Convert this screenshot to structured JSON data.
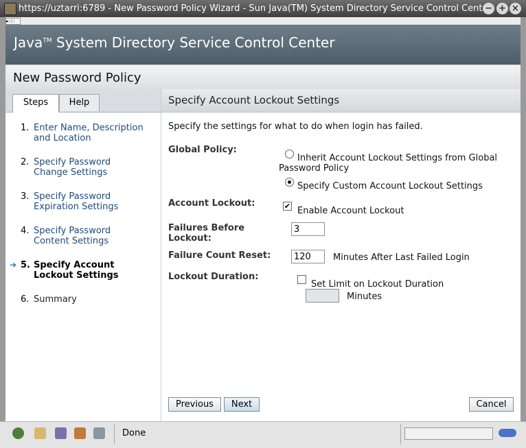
{
  "window": {
    "title": "https://uztarri:6789 - New Password Policy Wizard - Sun Java(TM) System Directory Service Control Center"
  },
  "banner": {
    "product_main": "Java",
    "product_tm": "TM",
    "product_rest": " System Directory Service Control Center"
  },
  "page": {
    "title": "New Password Policy"
  },
  "tabs": [
    {
      "label": "Steps"
    },
    {
      "label": "Help"
    }
  ],
  "steps": [
    {
      "num": "1.",
      "label": "Enter Name, Description and Location"
    },
    {
      "num": "2.",
      "label": "Specify Password Change Settings"
    },
    {
      "num": "3.",
      "label": "Specify Password Expiration Settings"
    },
    {
      "num": "4.",
      "label": "Specify Password Content Settings"
    },
    {
      "num": "5.",
      "label": "Specify Account Lockout Settings"
    },
    {
      "num": "6.",
      "label": "Summary"
    }
  ],
  "current_step_arrow": "➔",
  "content": {
    "heading": "Specify Account Lockout Settings",
    "intro": "Specify the settings for what to do when login has failed.",
    "global_policy": {
      "label": "Global Policy:",
      "option_inherit_line1": "Inherit Account Lockout Settings from Global",
      "option_inherit_line2": "Password Policy",
      "option_custom": "Specify Custom Account Lockout Settings",
      "selected": "custom"
    },
    "account_lockout": {
      "label": "Account Lockout:",
      "checkbox_label": "Enable Account Lockout",
      "checked": true,
      "check_glyph": "✔"
    },
    "failures_before_lockout": {
      "label_line1": "Failures Before",
      "label_line2": "Lockout:",
      "value": "3"
    },
    "failure_count_reset": {
      "label": "Failure Count Reset:",
      "value": "120",
      "suffix": "Minutes After Last Failed Login"
    },
    "lockout_duration": {
      "label": "Lockout Duration:",
      "checkbox_label": "Set Limit on Lockout Duration",
      "checked": false,
      "value": "",
      "suffix": "Minutes"
    }
  },
  "buttons": {
    "previous": "Previous",
    "next": "Next",
    "cancel": "Cancel"
  },
  "statusbar": {
    "text": "Done"
  }
}
